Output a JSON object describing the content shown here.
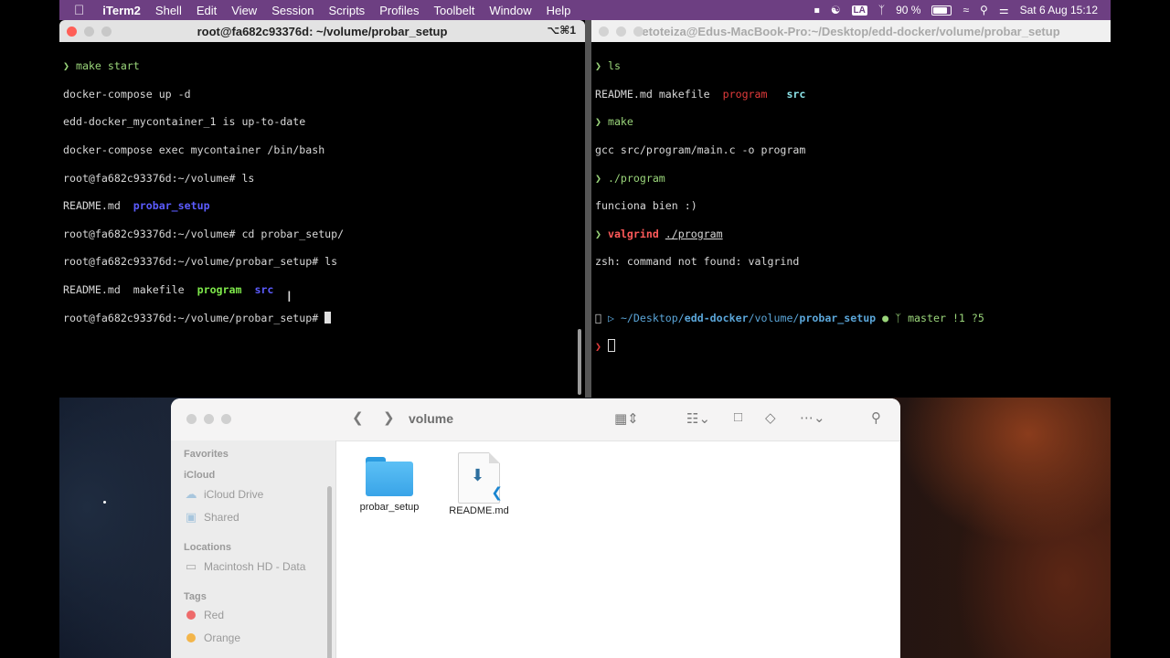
{
  "menubar": {
    "apple_icon": "apple-icon",
    "app_name": "iTerm2",
    "items": [
      "Shell",
      "Edit",
      "View",
      "Session",
      "Scripts",
      "Profiles",
      "Toolbelt",
      "Window",
      "Help"
    ],
    "battery_percent": "90 %",
    "battery_level": 0.9,
    "datetime": "Sat 6 Aug  15:12",
    "input_source": "LA"
  },
  "terminal_left": {
    "title": "root@fa682c93376d: ~/volume/probar_setup",
    "shortcut": "⌥⌘1",
    "lines": {
      "l1_prompt": "❯",
      "l1_cmd": "make start",
      "l2": "docker-compose up -d",
      "l3": "edd-docker_mycontainer_1 is up-to-date",
      "l4": "docker-compose exec mycontainer /bin/bash",
      "l5": "root@fa682c93376d:~/volume# ls",
      "l6_readme": "README.md",
      "l6_dir": "probar_setup",
      "l7": "root@fa682c93376d:~/volume# cd probar_setup/",
      "l8": "root@fa682c93376d:~/volume/probar_setup# ls",
      "l9_readme": "README.md",
      "l9_makefile": "makefile",
      "l9_program": "program",
      "l9_src": "src",
      "l10": "root@fa682c93376d:~/volume/probar_setup#"
    }
  },
  "terminal_right": {
    "title": "etoteiza@Edus-MacBook-Pro:~/Desktop/edd-docker/volume/probar_setup",
    "lines": {
      "l1_prompt": "❯",
      "l1_cmd": "ls",
      "l2_readme": "README.md",
      "l2_makefile": "makefile",
      "l2_program": "program",
      "l2_src": "src",
      "l3_prompt": "❯",
      "l3_cmd": "make",
      "l4": "gcc src/program/main.c -o program",
      "l5_prompt": "❯",
      "l5_cmd": "./program",
      "l6": "funciona bien :)",
      "l7_prompt": "❯",
      "l7_cmd": "valgrind",
      "l7_arg": "./program",
      "l8": "zsh: command not found: valgrind",
      "p_path_pre": "~/Desktop/",
      "p_path_1": "edd-docker",
      "p_path_sep": "/volume/",
      "p_path_2": "probar_setup",
      "p_branch": "master !1 ?5",
      "p_prompt": "❯"
    }
  },
  "finder": {
    "folder_title": "volume",
    "sidebar": {
      "favorites": "Favorites",
      "icloud": "iCloud",
      "icloud_drive": "iCloud Drive",
      "shared": "Shared",
      "locations": "Locations",
      "macintosh_hd": "Macintosh HD - Data",
      "tags": "Tags",
      "tag_red": "Red",
      "tag_orange": "Orange"
    },
    "files": [
      {
        "name": "probar_setup",
        "kind": "folder"
      },
      {
        "name": "README.md",
        "kind": "markdown-document"
      }
    ]
  },
  "colors": {
    "menubar": "#6d3f82",
    "tag_red": "#ee6b6b",
    "tag_orange": "#f3b54a"
  }
}
